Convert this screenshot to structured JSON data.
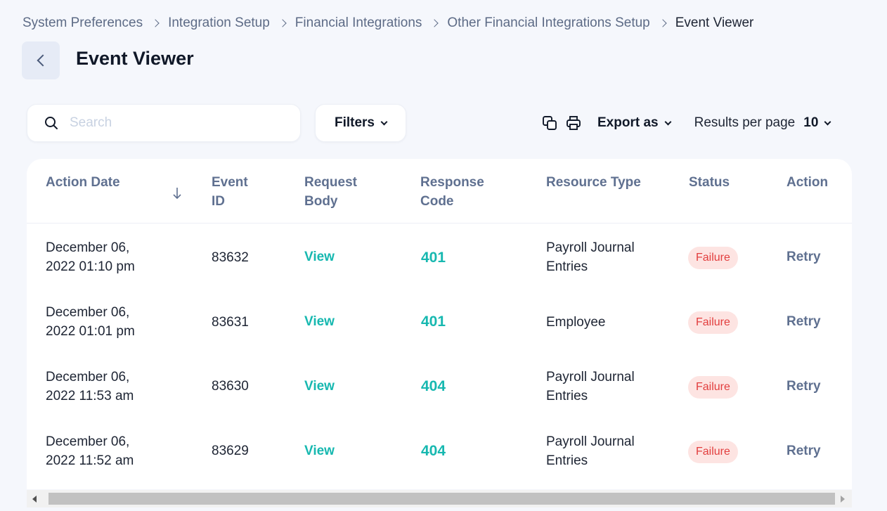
{
  "breadcrumb": [
    "System Preferences",
    "Integration Setup",
    "Financial Integrations",
    "Other Financial Integrations Setup",
    "Event Viewer"
  ],
  "page_title": "Event Viewer",
  "search": {
    "placeholder": "Search",
    "value": ""
  },
  "filters_label": "Filters",
  "export_label": "Export as",
  "results_per_page": {
    "label": "Results per page",
    "value": "10"
  },
  "table": {
    "headers": {
      "action_date": "Action Date",
      "event_id_1": "Event",
      "event_id_2": "ID",
      "request_body_1": "Request",
      "request_body_2": "Body",
      "response_code_1": "Response",
      "response_code_2": "Code",
      "resource_type": "Resource Type",
      "status": "Status",
      "action": "Action"
    },
    "rows": [
      {
        "date_1": "December 06,",
        "date_2": "2022 01:10 pm",
        "event_id": "83632",
        "request": "View",
        "code": "401",
        "resource_1": "Payroll Journal",
        "resource_2": "Entries",
        "status": "Failure",
        "action": "Retry"
      },
      {
        "date_1": "December 06,",
        "date_2": "2022 01:01 pm",
        "event_id": "83631",
        "request": "View",
        "code": "401",
        "resource_1": "Employee",
        "resource_2": "",
        "status": "Failure",
        "action": "Retry"
      },
      {
        "date_1": "December 06,",
        "date_2": "2022 11:53 am",
        "event_id": "83630",
        "request": "View",
        "code": "404",
        "resource_1": "Payroll Journal",
        "resource_2": "Entries",
        "status": "Failure",
        "action": "Retry"
      },
      {
        "date_1": "December 06,",
        "date_2": "2022 11:52 am",
        "event_id": "83629",
        "request": "View",
        "code": "404",
        "resource_1": "Payroll Journal",
        "resource_2": "Entries",
        "status": "Failure",
        "action": "Retry"
      }
    ]
  },
  "icons": {
    "back": "chevron-left-icon",
    "search": "search-icon",
    "copy": "copy-icon",
    "print": "printer-icon",
    "sort": "arrow-down-icon"
  },
  "colors": {
    "accent": "#17b8b0",
    "failure_bg": "#fde4e2",
    "failure_text": "#e23e3e",
    "header_text": "#5f7090"
  }
}
